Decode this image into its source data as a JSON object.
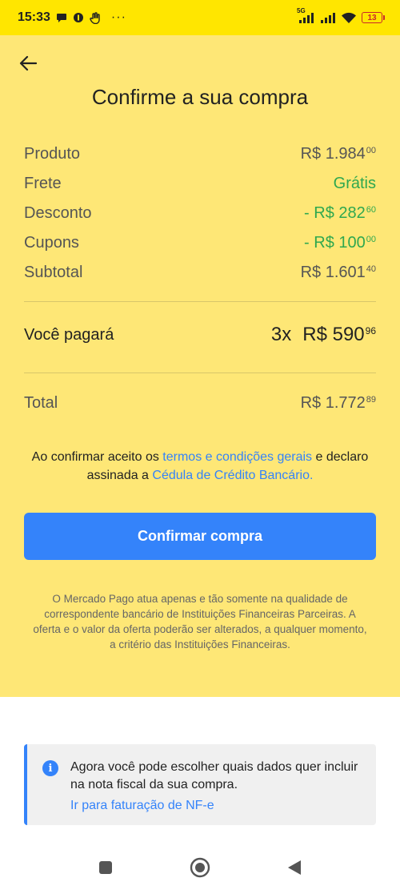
{
  "status_bar": {
    "time": "15:33",
    "left_icons": [
      "chat-bubble-icon",
      "shield-icon",
      "hand-icon",
      "more-dots-icon"
    ],
    "more": "···",
    "network": "5G",
    "battery": "13"
  },
  "header": {
    "back_icon": "arrow-left-icon",
    "title": "Confirme a sua compra"
  },
  "summary": {
    "rows": [
      {
        "label": "Produto",
        "amount": "R$ 1.984",
        "cents": "00",
        "green": false
      },
      {
        "label": "Frete",
        "amount": "Grátis",
        "cents": "",
        "green": true
      },
      {
        "label": "Desconto",
        "amount": "- R$ 282",
        "cents": "60",
        "green": true
      },
      {
        "label": "Cupons",
        "amount": "- R$ 100",
        "cents": "00",
        "green": true
      },
      {
        "label": "Subtotal",
        "amount": "R$ 1.601",
        "cents": "40",
        "green": false
      }
    ]
  },
  "payment": {
    "label": "Você pagará",
    "installments": "3x",
    "amount": "R$ 590",
    "cents": "96"
  },
  "total": {
    "label": "Total",
    "amount": "R$ 1.772",
    "cents": "89"
  },
  "terms": {
    "prefix": "Ao confirmar aceito os ",
    "terms_link": "termos e condições gerais",
    "middle": " e declaro assinada a ",
    "ccb_link": "Cédula de Crédito Bancário."
  },
  "confirm_button": "Confirmar compra",
  "disclaimer": "O Mercado Pago atua apenas e tão somente na qualidade de correspondente bancário de Instituições Financeiras Parceiras. A oferta e o valor da oferta poderão ser alterados, a qualquer momento, a critério das Instituições Financeiras.",
  "info_card": {
    "icon": "info-icon",
    "icon_glyph": "i",
    "text": "Agora você pode escolher quais dados quer incluir na nota fiscal da sua compra.",
    "link": "Ir para faturação de NF-e"
  },
  "nav_bar": {
    "buttons": [
      "recents-square-icon",
      "home-circle-icon",
      "back-triangle-icon"
    ]
  },
  "colors": {
    "status_bar": "#ffe600",
    "panel": "#fee776",
    "accent_blue": "#3483fa",
    "discount_green": "#2fa84f",
    "battery_red": "#c9272a"
  }
}
